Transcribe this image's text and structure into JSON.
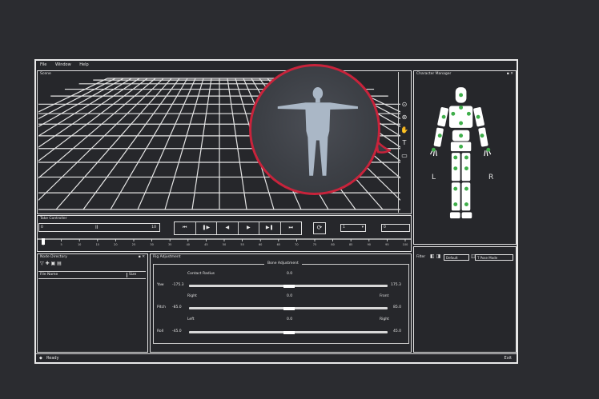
{
  "menu": {
    "items": [
      "File",
      "Window",
      "Help"
    ]
  },
  "viewport": {
    "title": "Scene"
  },
  "character_manager": {
    "title": "Character Manager",
    "side_left": "L",
    "side_right": "R"
  },
  "timeline": {
    "title": "Take Controller",
    "frame_left": "0",
    "frame_right": "10",
    "pause_symbol": "II",
    "transport": [
      "⏮",
      "❚▶",
      "◀",
      "▶",
      "▶❚",
      "⏭"
    ],
    "dropdown_value": "1",
    "field_value": "0",
    "ticks": [
      "0",
      "5",
      "10",
      "15",
      "20",
      "25",
      "30",
      "35",
      "40",
      "45",
      "50",
      "55",
      "60",
      "65",
      "70",
      "75",
      "80",
      "85",
      "90",
      "95",
      "100"
    ]
  },
  "node_directory": {
    "title": "Node Directory",
    "col_name": "File Name",
    "col_size": "Size"
  },
  "rig_panel": {
    "title": "Rig Adjustment",
    "section": "Bone Adjustment",
    "rows": [
      {
        "label": "Contact Radius",
        "value": "0.0",
        "left": "",
        "right": ""
      },
      {
        "label": "Yaw",
        "value": "",
        "left": "-175.3",
        "right": "175.3"
      },
      {
        "label": "Right",
        "value": "0.0",
        "left": "",
        "right": "Front"
      },
      {
        "label": "Pitch",
        "value": "",
        "left": "-85.0",
        "right": "85.0"
      },
      {
        "label": "Left",
        "value": "0.0",
        "left": "",
        "right": "Right"
      },
      {
        "label": "Roll",
        "value": "",
        "left": "-45.0",
        "right": "45.0"
      }
    ]
  },
  "right_panel": {
    "label": "Filter",
    "dropdown1": "Default",
    "dropdown2": "T Pose Mode"
  },
  "status": {
    "left": "Ready",
    "right": "Exit"
  },
  "colors": {
    "accent": "#c8233b",
    "joint": "#3fae4a",
    "background": "#2b2c30"
  }
}
